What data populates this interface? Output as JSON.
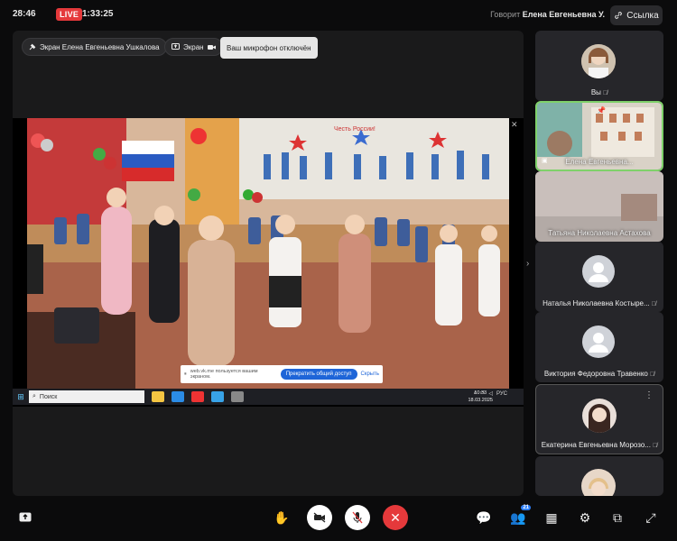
{
  "topbar": {
    "time": "28:46",
    "live_label": "LIVE",
    "duration": "1:33:25",
    "speaker_prefix": "Говорит",
    "speaker_name": "Елена Евгеньевна У.",
    "link_label": "Ссылка"
  },
  "stage": {
    "pin_label": "Экран Елена Евгеньевна Ушкалова",
    "screen_label": "Экран",
    "mic_toast": "Ваш микрофон отключён"
  },
  "shared_screen": {
    "share_message": "web.vk.me пользуется вашим экраном.",
    "stop_label": "Прекратить общий доступ",
    "hide_label": "Скрыть",
    "search_label": "Поиск",
    "tray_lang": "РУС",
    "clock_time": "10:33",
    "clock_date": "18.03.2025",
    "poster_text": "Честь России!"
  },
  "participants": [
    {
      "name": "Вы",
      "avatar": "photo-woman-light"
    },
    {
      "name": "Елена Евгеньевна...",
      "avatar": "video-classroom"
    },
    {
      "name": "Татьяна Николаевна Астахова",
      "avatar": "video-room"
    },
    {
      "name": "Наталья Николаевна Костыре...",
      "avatar": "generic-user"
    },
    {
      "name": "Виктория Федоровна Травенко",
      "avatar": "generic-user"
    },
    {
      "name": "Екатерина Евгеньевна Морозо...",
      "avatar": "photo-woman-dark"
    }
  ],
  "bottom": {
    "participants_count": "21"
  },
  "colors": {
    "live": "#e5393b",
    "end_call": "#e5393b",
    "active_tile_border": "#7fd16a",
    "accent": "#2d7ff9"
  }
}
